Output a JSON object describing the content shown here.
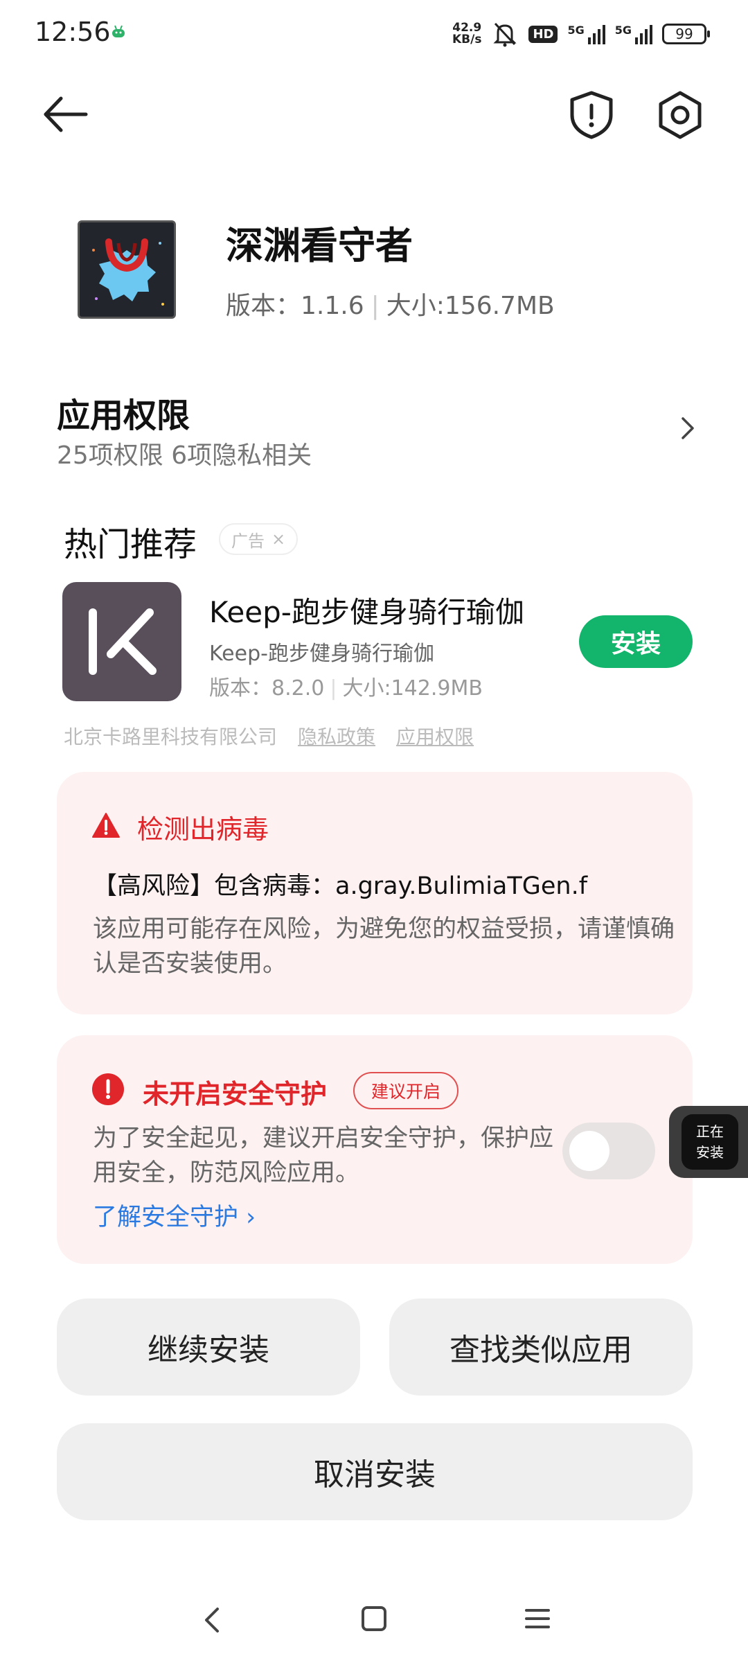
{
  "status_bar": {
    "time": "12:56",
    "net_speed_value": "42.9",
    "net_speed_unit": "KB/s",
    "hd_label": "HD",
    "sim1_label": "5G",
    "sim2_label": "5G",
    "battery": "99"
  },
  "icons": {
    "back": "back-arrow-icon",
    "shield": "shield-icon",
    "settings": "gear-icon"
  },
  "app": {
    "name": "深渊看守者",
    "version_label": "版本：1.1.6",
    "size_label": "大小:156.7MB"
  },
  "permissions": {
    "title": "应用权限",
    "summary": "25项权限 6项隐私相关"
  },
  "recommended": {
    "title": "热门推荐",
    "ad_label": "广告",
    "ad_close": "×",
    "app_name": "Keep-跑步健身骑行瑜伽",
    "app_desc": "Keep-跑步健身骑行瑜伽",
    "version_label": "版本：8.2.0",
    "size_label": "大小:142.9MB",
    "install_label": "安装",
    "developer": "北京卡路里科技有限公司",
    "privacy_link": "隐私政策",
    "permission_link": "应用权限",
    "brand_color": "#584f5b"
  },
  "virus_warning": {
    "title": "检测出病毒",
    "detail": "【高风险】包含病毒：a.gray.BulimiaTGen.f",
    "description": "该应用可能存在风险，为避免您的权益受损，请谨慎确认是否安装使用。",
    "accent_color": "#e0262a"
  },
  "protection": {
    "title": "未开启安全守护",
    "badge": "建议开启",
    "description": "为了安全起见，建议开启安全守护，保护应用安全，防范风险应用。",
    "link": "了解安全守护 ›",
    "toggle_on": false,
    "link_color": "#2a7ae2"
  },
  "floating": {
    "line1": "正在",
    "line2": "安装"
  },
  "actions": {
    "continue_label": "继续安装",
    "similar_label": "查找类似应用",
    "cancel_label": "取消安装"
  }
}
